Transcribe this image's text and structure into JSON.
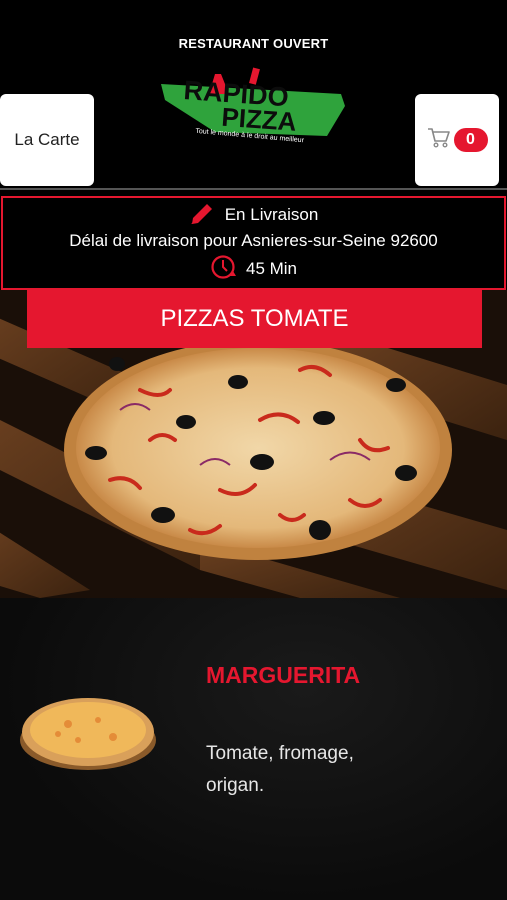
{
  "status": {
    "text": "RESTAURANT OUVERT"
  },
  "header": {
    "menu_button_label": "La Carte",
    "cart_count": "0",
    "logo": {
      "line1": "RAPIDO",
      "line2": "PIZZA",
      "tagline": "Tout le monde à le droit au meilleur"
    }
  },
  "delivery": {
    "mode": "En Livraison",
    "info": "Délai de livraison pour Asnieres-sur-Seine 92600",
    "time": "45 Min"
  },
  "category": {
    "title": "PIZZAS TOMATE"
  },
  "products": [
    {
      "name": "MARGUERITA",
      "description": "Tomate, fromage, origan."
    }
  ],
  "colors": {
    "accent": "#e5172f",
    "logo_green": "#2fa33c",
    "background": "#000000"
  }
}
